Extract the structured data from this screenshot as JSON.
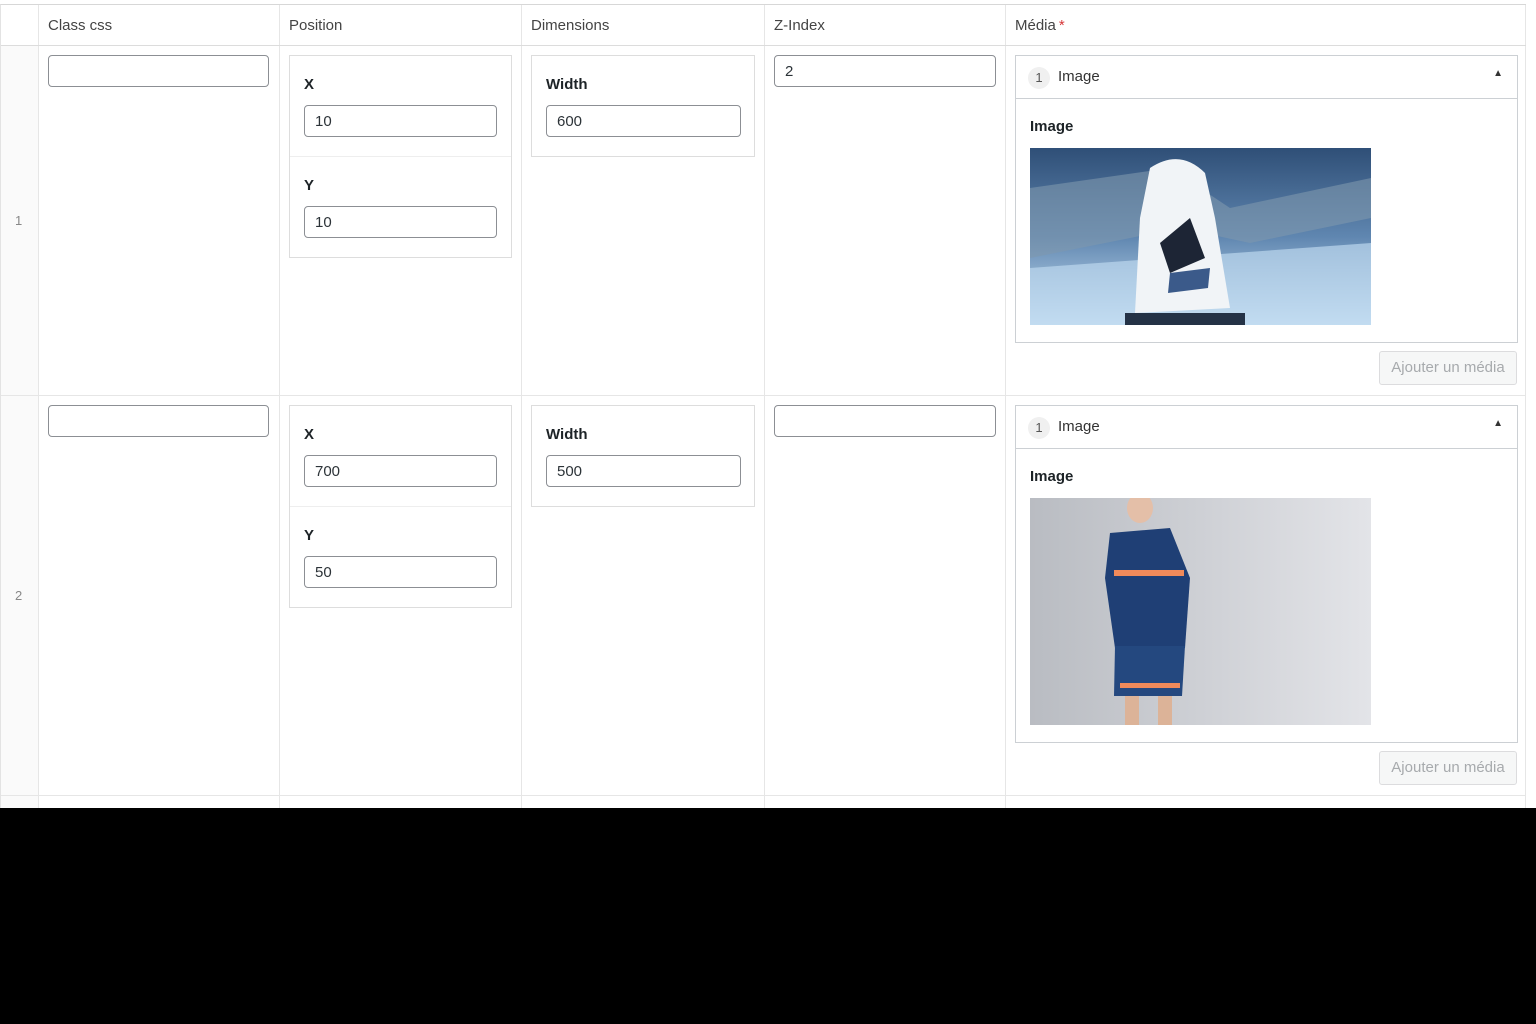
{
  "columns": {
    "class_css": "Class css",
    "position": "Position",
    "dimensions": "Dimensions",
    "z_index": "Z-Index",
    "media": "Média",
    "media_required": "*"
  },
  "rows": [
    {
      "number": "1",
      "class_css": "",
      "x_label": "X",
      "x": "10",
      "y_label": "Y",
      "y": "10",
      "width_label": "Width",
      "width": "600",
      "z_index": "2",
      "media_layout": {
        "index": "1",
        "title": "Image",
        "toggle": "▲"
      },
      "image_label": "Image",
      "image_alt": "Person in white hoodie sitting on a beach",
      "add_button": "Ajouter un média"
    },
    {
      "number": "2",
      "class_css": "",
      "x_label": "X",
      "x": "700",
      "y_label": "Y",
      "y": "50",
      "width_label": "Width",
      "width": "500",
      "z_index": "",
      "media_layout": {
        "index": "1",
        "title": "Image",
        "toggle": "▲"
      },
      "image_label": "Image",
      "image_alt": "Model in navy sweatshirt and shorts against grey wall",
      "add_button": "Ajouter un média"
    }
  ],
  "colors": {
    "required": "#d63638",
    "border": "#8c8f94",
    "muted_button": "#a7aaad"
  }
}
